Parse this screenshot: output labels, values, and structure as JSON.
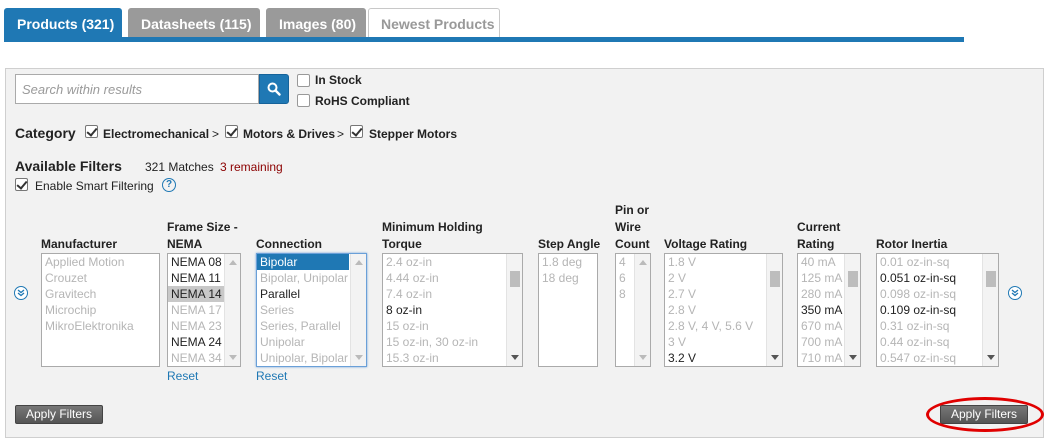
{
  "tabs": [
    {
      "label": "Products (321)"
    },
    {
      "label": "Datasheets (115)"
    },
    {
      "label": "Images (80)"
    },
    {
      "label": "Newest Products"
    }
  ],
  "search": {
    "placeholder": "Search within results"
  },
  "checkboxes": {
    "in_stock": "In Stock",
    "rohs": "RoHS Compliant"
  },
  "category": {
    "label": "Category",
    "crumbs": [
      "Electromechanical",
      "Motors & Drives",
      "Stepper Motors"
    ],
    "sep": ">"
  },
  "filters": {
    "title": "Available Filters",
    "matches": "321 Matches",
    "remaining": "3 remaining",
    "smart": "Enable Smart Filtering",
    "help": "?"
  },
  "columns": {
    "manufacturer": {
      "head": "Manufacturer",
      "options": [
        "Applied Motion",
        "Crouzet",
        "Gravitech",
        "Microchip",
        "MikroElektronika"
      ]
    },
    "frame_size": {
      "head1": "Frame Size -",
      "head2": "NEMA",
      "options": [
        "NEMA 08",
        "NEMA 11",
        "NEMA 14",
        "NEMA 17",
        "NEMA 23",
        "NEMA 24",
        "NEMA 34"
      ],
      "reset": "Reset"
    },
    "connection": {
      "head": "Connection",
      "options": [
        "Bipolar",
        "Bipolar, Unipolar",
        "Parallel",
        "Series",
        "Series, Parallel",
        "Unipolar",
        "Unipolar, Bipolar"
      ],
      "reset": "Reset"
    },
    "holding_torque": {
      "head1": "Minimum Holding",
      "head2": "Torque",
      "options": [
        "2.4 oz-in",
        "4.44 oz-in",
        "7.4 oz-in",
        "8 oz-in",
        "15 oz-in",
        "15 oz-in, 30 oz-in",
        "15.3 oz-in"
      ]
    },
    "step_angle": {
      "head": "Step Angle",
      "options": [
        "1.8 deg",
        "18 deg"
      ]
    },
    "pin_count": {
      "head1": "Pin or",
      "head2": "Wire",
      "head3": "Count",
      "options": [
        "4",
        "6",
        "8"
      ]
    },
    "voltage": {
      "head": "Voltage Rating",
      "options": [
        "1.8 V",
        "2 V",
        "2.7 V",
        "2.8 V",
        "2.8 V, 4 V, 5.6 V",
        "3 V",
        "3.2 V"
      ]
    },
    "current": {
      "head1": "Current",
      "head2": "Rating",
      "options": [
        "40 mA",
        "125 mA",
        "280 mA",
        "350 mA",
        "670 mA",
        "700 mA",
        "710 mA"
      ]
    },
    "rotor_inertia": {
      "head": "Rotor Inertia",
      "options": [
        "0.01 oz-in-sq",
        "0.051 oz-in-sq",
        "0.098 oz-in-sq",
        "0.109 oz-in-sq",
        "0.31 oz-in-sq",
        "0.44 oz-in-sq",
        "0.547 oz-in-sq"
      ]
    }
  },
  "buttons": {
    "apply_left": "Apply Filters",
    "apply_right": "Apply Filters"
  },
  "colors": {
    "accent": "#1f78b4",
    "highlight": "#e00000",
    "remaining": "#8b0000"
  }
}
